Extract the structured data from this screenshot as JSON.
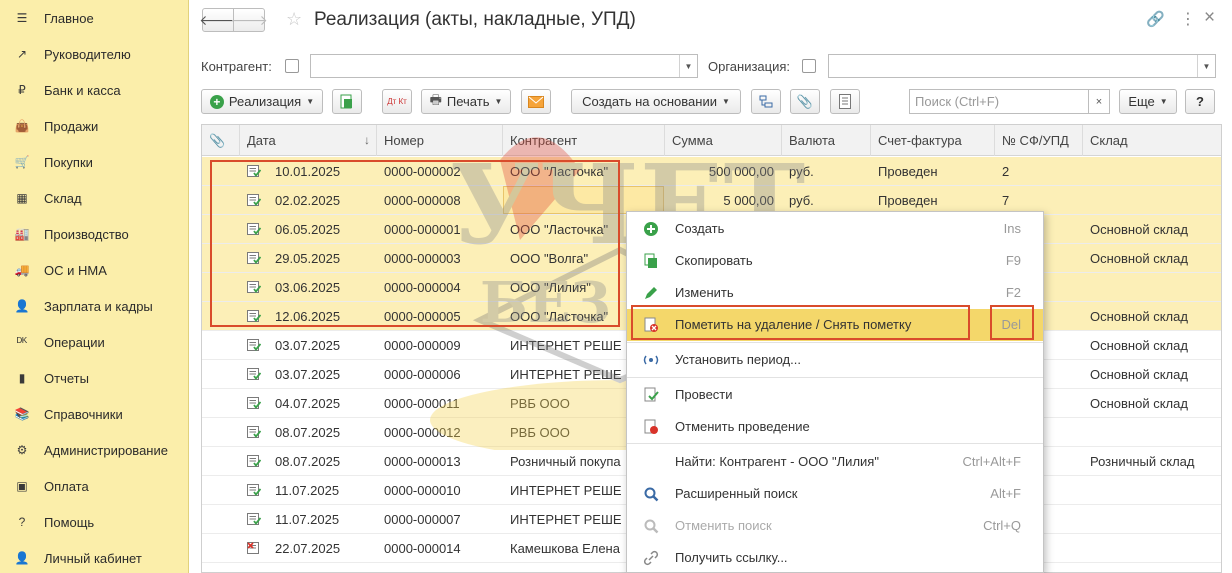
{
  "sidebar": {
    "items": [
      {
        "label": "Главное",
        "icon": "menu-icon"
      },
      {
        "label": "Руководителю",
        "icon": "trend-icon"
      },
      {
        "label": "Банк и касса",
        "icon": "coin-icon"
      },
      {
        "label": "Продажи",
        "icon": "bag-icon"
      },
      {
        "label": "Покупки",
        "icon": "cart-icon"
      },
      {
        "label": "Склад",
        "icon": "warehouse-icon"
      },
      {
        "label": "Производство",
        "icon": "factory-icon"
      },
      {
        "label": "ОС и НМА",
        "icon": "truck-icon"
      },
      {
        "label": "Зарплата и кадры",
        "icon": "person-icon"
      },
      {
        "label": "Операции",
        "icon": "dt-kt-icon"
      },
      {
        "label": "Отчеты",
        "icon": "bar-chart-icon"
      },
      {
        "label": "Справочники",
        "icon": "book-icon"
      },
      {
        "label": "Администрирование",
        "icon": "gear-icon"
      },
      {
        "label": "Оплата",
        "icon": "payment-icon"
      },
      {
        "label": "Помощь",
        "icon": "question-icon"
      },
      {
        "label": "Личный кабинет",
        "icon": "user-icon"
      }
    ]
  },
  "header": {
    "title": "Реализация (акты, накладные, УПД)"
  },
  "filters": {
    "counterparty_label": "Контрагент:",
    "organization_label": "Организация:"
  },
  "toolbar": {
    "create_label": "Реализация",
    "dt_kt_label": "Дт Кт",
    "print_label": "Печать",
    "based_on_label": "Создать на основании",
    "search_placeholder": "Поиск (Ctrl+F)",
    "clear_label": "×",
    "more_label": "Еще",
    "help_label": "?"
  },
  "table": {
    "columns": [
      "Дата",
      "Номер",
      "Контрагент",
      "Сумма",
      "Валюта",
      "Счет-фактура",
      "№ СФ/УПД",
      "Склад"
    ],
    "sort_indicator": "↓",
    "rows": [
      {
        "date": "10.01.2025",
        "number": "0000-000002",
        "counterparty": "ООО \"Ласточка\"",
        "sum": "500 000,00",
        "currency": "руб.",
        "invoice": "Проведен",
        "sf": "2",
        "warehouse": "",
        "selected": true
      },
      {
        "date": "02.02.2025",
        "number": "0000-000008",
        "counterparty": "ООО \"Лилия\"",
        "sum": "5 000,00",
        "currency": "руб.",
        "invoice": "Проведен",
        "sf": "7",
        "warehouse": "",
        "selected": true
      },
      {
        "date": "06.05.2025",
        "number": "0000-000001",
        "counterparty": "ООО \"Ласточка\"",
        "sum": "",
        "currency": "",
        "invoice": "",
        "sf": "",
        "warehouse": "Основной склад",
        "selected": true
      },
      {
        "date": "29.05.2025",
        "number": "0000-000003",
        "counterparty": "ООО \"Волга\"",
        "sum": "",
        "currency": "",
        "invoice": "",
        "sf": "",
        "warehouse": "Основной склад",
        "selected": true
      },
      {
        "date": "03.06.2025",
        "number": "0000-000004",
        "counterparty": "ООО \"Лилия\"",
        "sum": "",
        "currency": "",
        "invoice": "",
        "sf": "",
        "warehouse": "",
        "selected": true
      },
      {
        "date": "12.06.2025",
        "number": "0000-000005",
        "counterparty": "ООО \"Ласточка\"",
        "sum": "",
        "currency": "",
        "invoice": "",
        "sf": "",
        "warehouse": "Основной склад",
        "selected": true
      },
      {
        "date": "03.07.2025",
        "number": "0000-000009",
        "counterparty": "ИНТЕРНЕТ РЕШЕ",
        "sum": "",
        "currency": "",
        "invoice": "",
        "sf": "",
        "warehouse": "Основной склад",
        "selected": false
      },
      {
        "date": "03.07.2025",
        "number": "0000-000006",
        "counterparty": "ИНТЕРНЕТ РЕШЕ",
        "sum": "",
        "currency": "",
        "invoice": "",
        "sf": "",
        "warehouse": "Основной склад",
        "selected": false
      },
      {
        "date": "04.07.2025",
        "number": "0000-000011",
        "counterparty": "РВБ ООО",
        "sum": "",
        "currency": "",
        "invoice": "",
        "sf": "",
        "warehouse": "Основной склад",
        "selected": false
      },
      {
        "date": "08.07.2025",
        "number": "0000-000012",
        "counterparty": "РВБ ООО",
        "sum": "",
        "currency": "",
        "invoice": "",
        "sf": "",
        "warehouse": "",
        "selected": false
      },
      {
        "date": "08.07.2025",
        "number": "0000-000013",
        "counterparty": "Розничный покупа",
        "sum": "",
        "currency": "",
        "invoice": "",
        "sf": "",
        "warehouse": "Розничный склад",
        "selected": false
      },
      {
        "date": "11.07.2025",
        "number": "0000-000010",
        "counterparty": "ИНТЕРНЕТ РЕШЕ",
        "sum": "",
        "currency": "",
        "invoice": "",
        "sf": "",
        "warehouse": "",
        "selected": false
      },
      {
        "date": "11.07.2025",
        "number": "0000-000007",
        "counterparty": "ИНТЕРНЕТ РЕШЕ",
        "sum": "",
        "currency": "",
        "invoice": "",
        "sf": "",
        "warehouse": "",
        "selected": false
      },
      {
        "date": "22.07.2025",
        "number": "0000-000014",
        "counterparty": "Камешкова Елена",
        "sum": "",
        "currency": "",
        "invoice": "",
        "sf": "",
        "warehouse": "",
        "selected": false,
        "deleted": true
      }
    ]
  },
  "context_menu": {
    "items": [
      {
        "label": "Создать",
        "key": "Ins",
        "icon": "add-icon"
      },
      {
        "label": "Скопировать",
        "key": "F9",
        "icon": "copy-icon"
      },
      {
        "label": "Изменить",
        "key": "F2",
        "icon": "edit-icon"
      },
      {
        "label": "Пометить на удаление / Снять пометку",
        "key": "Del",
        "icon": "mark-delete-icon",
        "highlight": true
      },
      {
        "label": "Установить период...",
        "key": "",
        "icon": "period-icon"
      },
      {
        "label": "Провести",
        "key": "",
        "icon": "post-icon"
      },
      {
        "label": "Отменить проведение",
        "key": "",
        "icon": "unpost-icon"
      },
      {
        "label": "Найти: Контрагент - ООО \"Лилия\"",
        "key": "Ctrl+Alt+F",
        "icon": "find-icon"
      },
      {
        "label": "Расширенный поиск",
        "key": "Alt+F",
        "icon": "advanced-search-icon"
      },
      {
        "label": "Отменить поиск",
        "key": "Ctrl+Q",
        "icon": "cancel-search-icon",
        "disabled": true
      },
      {
        "label": "Получить ссылку...",
        "key": "",
        "icon": "link-icon"
      }
    ]
  },
  "watermark": {
    "line1": "УЧЕТ",
    "line2": "БЕЗ ЗАБОТ"
  },
  "colors": {
    "sidebar_bg": "#fbeeaa",
    "selected_row": "#fcefb7",
    "menu_highlight": "#f4d76a",
    "annotation_red": "#d94b2b",
    "posted_icon_green": "#3aa14a"
  }
}
